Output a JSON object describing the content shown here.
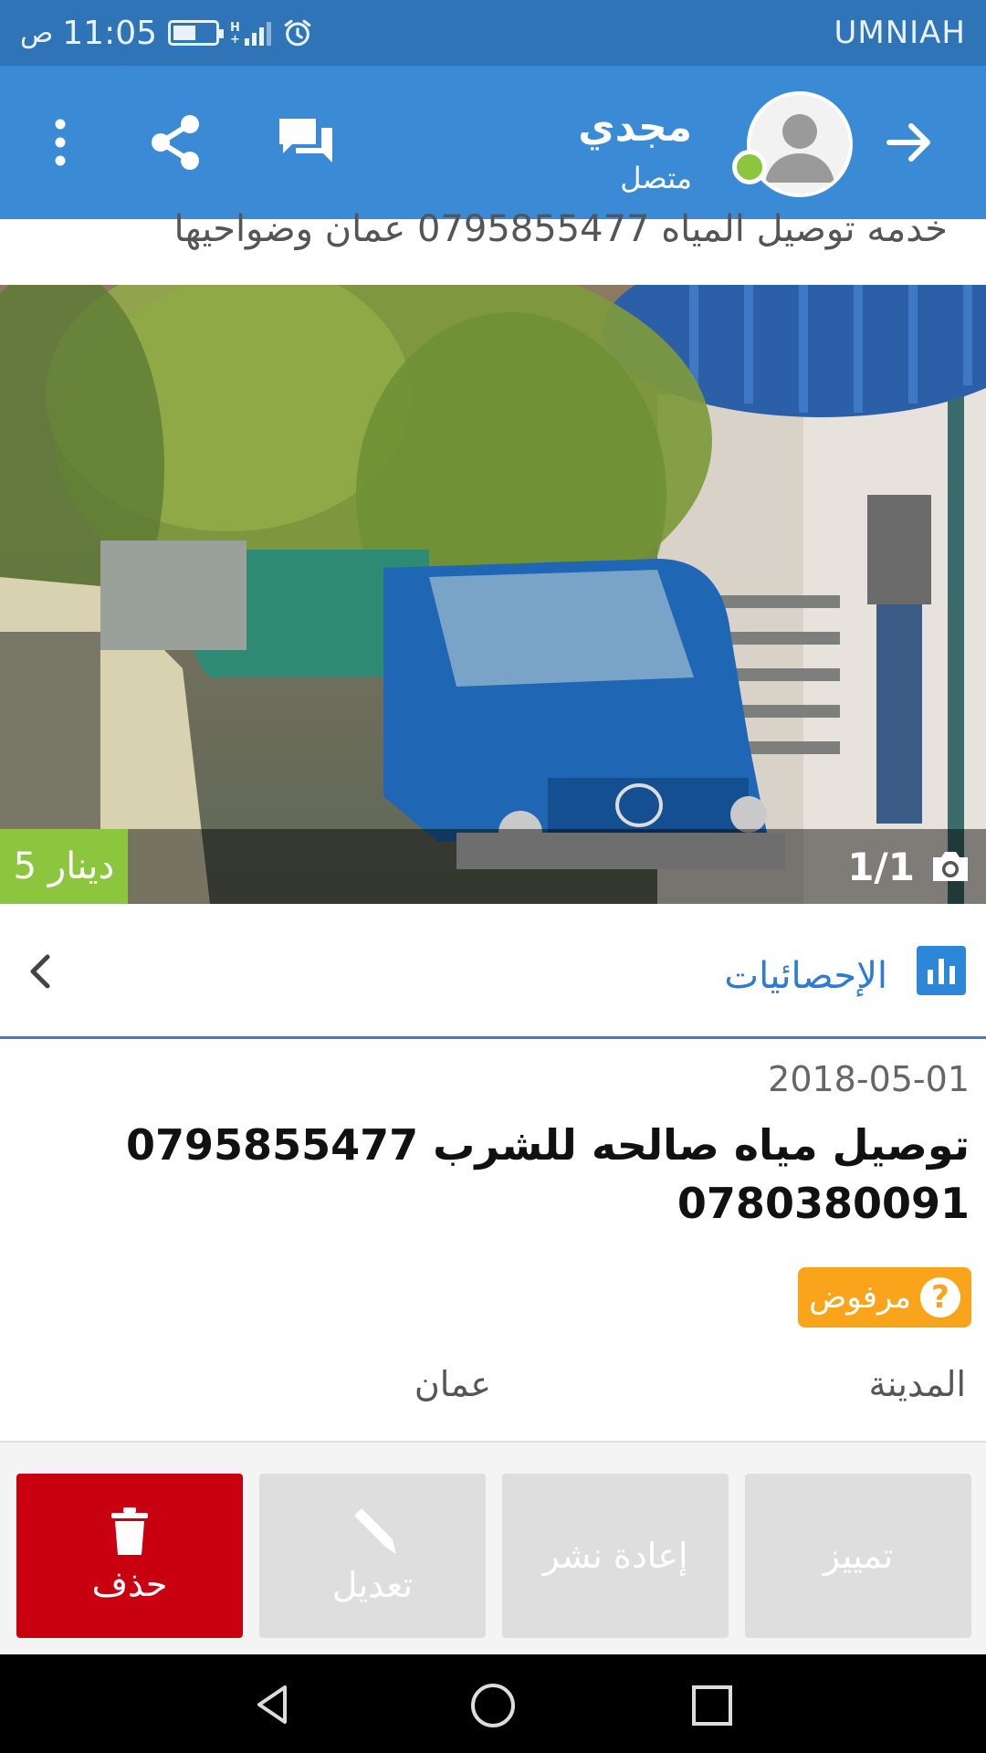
{
  "status_bar": {
    "time": "11:05",
    "ampm": "ص",
    "carrier": "UMNIAH",
    "battery_level": 0.55
  },
  "header": {
    "user_name": "مجدي",
    "user_status": "متصل",
    "icons": [
      "more-vert-icon",
      "share-icon",
      "chat-icon",
      "avatar",
      "forward-arrow-icon"
    ]
  },
  "banner": {
    "text": "خدمه توصيل المياه 0795855477 عمان وضواحيها"
  },
  "photo": {
    "price": "5 دينار",
    "counter": "1/1"
  },
  "stats": {
    "label": "الإحصائيات"
  },
  "post": {
    "date": "2018-05-01",
    "title": "توصيل مياه صالحه للشرب 0795855477 0780380091",
    "status": "مرفوض",
    "city_label": "المدينة",
    "city_value": "عمان"
  },
  "actions": {
    "delete": "حذف",
    "edit": "تعديل",
    "republish": "إعادة نشر",
    "feature": "تمييز"
  },
  "colors": {
    "app_bar": "#3b8ad5",
    "status_bar": "#2f74b7",
    "price_tag": "#8cc63f",
    "badge": "#f9a41a",
    "delete": "#c8000f"
  }
}
